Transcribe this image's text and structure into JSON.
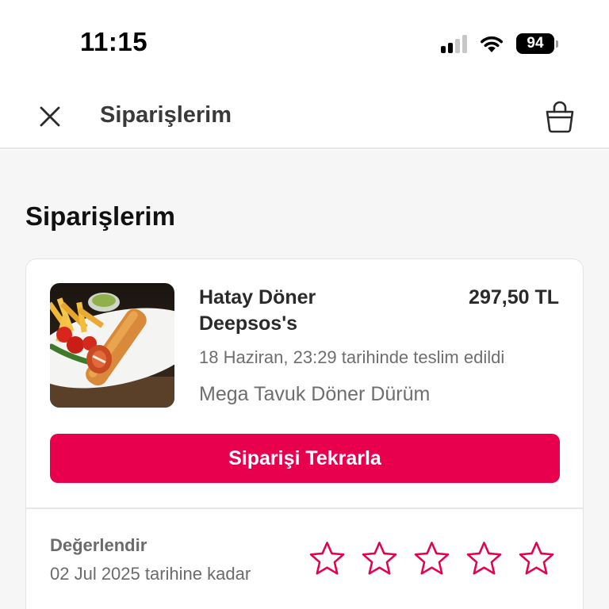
{
  "status_bar": {
    "time": "11:15",
    "battery_level": "94",
    "signal_bars_active": 2,
    "signal_bars_total": 4
  },
  "header": {
    "title": "Siparişlerim",
    "close_icon": "close-icon",
    "basket_icon": "shopping-bag-icon"
  },
  "page": {
    "title": "Siparişlerim"
  },
  "order": {
    "restaurant": "Hatay Döner Deepsos's",
    "price": "297,50 TL",
    "delivery_info": "18 Haziran, 23:29 tarihinde teslim edildi",
    "item": "Mega Tavuk Döner Dürüm",
    "reorder_label": "Siparişi Tekrarla"
  },
  "rating": {
    "label": "Değerlendir",
    "deadline": "02 Jul 2025 tarihine kadar",
    "stars_total": 5,
    "stars_selected": 0
  },
  "colors": {
    "accent": "#e8004f",
    "background": "#f6f6f6",
    "card": "#ffffff",
    "muted_text": "#6e6e6e"
  }
}
